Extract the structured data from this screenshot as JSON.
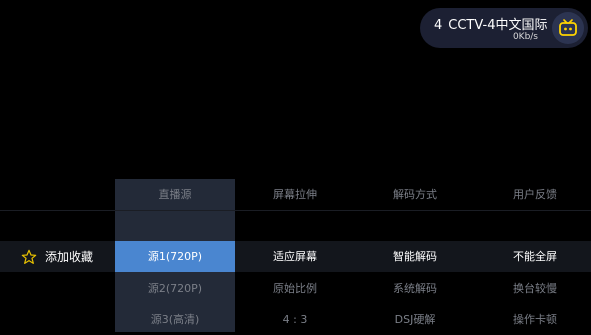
{
  "channel": {
    "number": "4",
    "name": "CCTV-4中文国际",
    "speed": "0Kb/s",
    "icon": "tv-icon"
  },
  "favorite": {
    "icon": "star-icon",
    "label": "添加收藏"
  },
  "menu": {
    "headers": [
      "直播源",
      "屏幕拉伸",
      "解码方式",
      "用户反馈"
    ],
    "rows": [
      [
        "源1(720P)",
        "适应屏幕",
        "智能解码",
        "不能全屏"
      ],
      [
        "源2(720P)",
        "原始比例",
        "系统解码",
        "换台较慢"
      ],
      [
        "源3(高清)",
        "4 : 3",
        "DSJ硬解",
        "操作卡顿"
      ]
    ]
  },
  "colors": {
    "active": "#4a86d0",
    "selected_row": "#13161c",
    "column_highlight": "#232a38",
    "pill": "#1c2033"
  }
}
